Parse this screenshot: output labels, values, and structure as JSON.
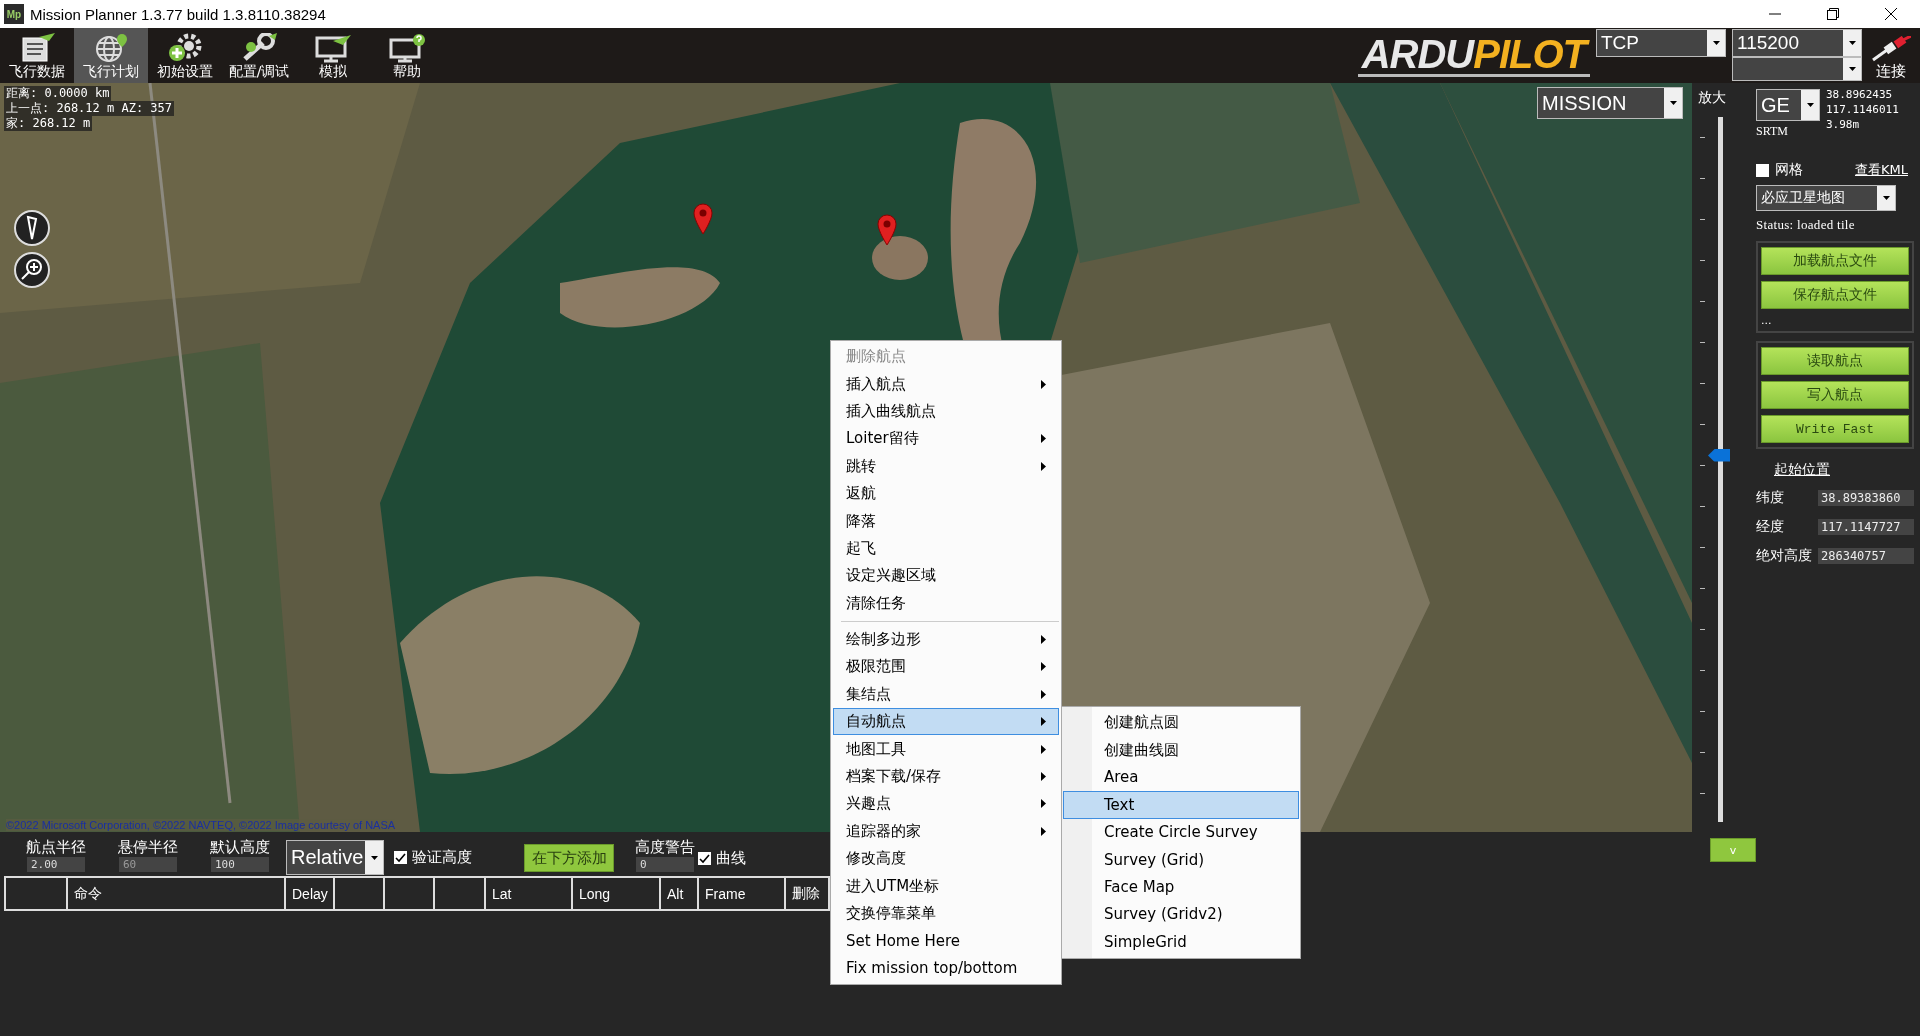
{
  "window": {
    "icon_text": "Mp",
    "title": "Mission Planner 1.3.77 build 1.3.8110.38294"
  },
  "toolbar": {
    "buttons": [
      {
        "label": "飞行数据",
        "selected": false
      },
      {
        "label": "飞行计划",
        "selected": true
      },
      {
        "label": "初始设置",
        "selected": false
      },
      {
        "label": "配置/调试",
        "selected": false
      },
      {
        "label": "模拟",
        "selected": false
      },
      {
        "label": "帮助",
        "selected": false
      }
    ],
    "logo": [
      "ARDU",
      "PILOT"
    ],
    "connection_type": "TCP",
    "baud_rate": "115200",
    "connect_label": "连接"
  },
  "map": {
    "info_lines": [
      "距离: 0.0000 km",
      "上一点: 268.12 m AZ: 357",
      "家: 268.12 m"
    ],
    "mode": "MISSION",
    "attribution": "©2022 Microsoft Corporation, ©2022 NAVTEQ, ©2022 Image courtesy of NASA"
  },
  "zoom": {
    "label": "放大",
    "level": 0.52
  },
  "side_panel": {
    "coord_system": "GE",
    "lat": "38.8962435",
    "lng": "117.1146011",
    "source": "SRTM",
    "alt": "3.98m",
    "grid": {
      "label": "网格",
      "checked": false
    },
    "kml_link": "查看KML",
    "map_type": "必应卫星地图",
    "status": "Status: loaded tile",
    "file_buttons": [
      "加载航点文件",
      "保存航点文件"
    ],
    "file_more": "...",
    "wp_buttons": [
      "读取航点",
      "写入航点",
      "Write Fast"
    ],
    "home": {
      "title": "起始位置",
      "fields": [
        {
          "label": "纬度",
          "value": "38.89383860"
        },
        {
          "label": "经度",
          "value": "117.1147727"
        },
        {
          "label": "绝对高度",
          "value": "286340757"
        }
      ]
    }
  },
  "mission_bar": {
    "fields": [
      {
        "label": "航点半径",
        "value": "2.00",
        "disabled": false
      },
      {
        "label": "悬停半径",
        "value": "60",
        "disabled": true
      },
      {
        "label": "默认高度",
        "value": "100",
        "disabled": false
      }
    ],
    "frame": "Relative",
    "verify_height": {
      "label": "验证高度",
      "checked": true
    },
    "add_below": "在下方添加",
    "alt_warning": {
      "label": "高度警告",
      "value": "0"
    },
    "spline": {
      "label": "曲线",
      "checked": true
    },
    "collapse": "v"
  },
  "table": {
    "columns": [
      "",
      "命令",
      "Delay",
      "",
      "",
      "",
      "Lat",
      "Long",
      "Alt",
      "Frame",
      "删除"
    ]
  },
  "context_menu": {
    "groups": [
      [
        {
          "label": "删除航点",
          "submenu": false,
          "disabled": true,
          "selected": false
        },
        {
          "label": "插入航点",
          "submenu": true,
          "disabled": false,
          "selected": false
        },
        {
          "label": "插入曲线航点",
          "submenu": false,
          "disabled": false,
          "selected": false
        },
        {
          "label": "Loiter留待",
          "submenu": true,
          "disabled": false,
          "selected": false
        },
        {
          "label": "跳转",
          "submenu": true,
          "disabled": false,
          "selected": false
        },
        {
          "label": "返航",
          "submenu": false,
          "disabled": false,
          "selected": false
        },
        {
          "label": "降落",
          "submenu": false,
          "disabled": false,
          "selected": false
        },
        {
          "label": "起飞",
          "submenu": false,
          "disabled": false,
          "selected": false
        },
        {
          "label": "设定兴趣区域",
          "submenu": false,
          "disabled": false,
          "selected": false
        },
        {
          "label": "清除任务",
          "submenu": false,
          "disabled": false,
          "selected": false
        }
      ],
      [
        {
          "label": "绘制多边形",
          "submenu": true,
          "disabled": false,
          "selected": false
        },
        {
          "label": "极限范围",
          "submenu": true,
          "disabled": false,
          "selected": false
        },
        {
          "label": "集结点",
          "submenu": true,
          "disabled": false,
          "selected": false
        },
        {
          "label": "自动航点",
          "submenu": true,
          "disabled": false,
          "selected": true
        },
        {
          "label": "地图工具",
          "submenu": true,
          "disabled": false,
          "selected": false
        },
        {
          "label": "档案下载/保存",
          "submenu": true,
          "disabled": false,
          "selected": false
        },
        {
          "label": "兴趣点",
          "submenu": true,
          "disabled": false,
          "selected": false
        },
        {
          "label": "追踪器的家",
          "submenu": true,
          "disabled": false,
          "selected": false
        },
        {
          "label": "修改高度",
          "submenu": false,
          "disabled": false,
          "selected": false
        },
        {
          "label": "进入UTM坐标",
          "submenu": false,
          "disabled": false,
          "selected": false
        },
        {
          "label": "交换停靠菜单",
          "submenu": false,
          "disabled": false,
          "selected": false
        },
        {
          "label": "Set Home Here",
          "submenu": false,
          "disabled": false,
          "selected": false
        },
        {
          "label": "Fix mission top/bottom",
          "submenu": false,
          "disabled": false,
          "selected": false
        }
      ]
    ],
    "submenu": [
      {
        "label": "创建航点圆",
        "selected": false
      },
      {
        "label": "创建曲线圆",
        "selected": false
      },
      {
        "label": "Area",
        "selected": false
      },
      {
        "label": "Text",
        "selected": true
      },
      {
        "label": "Create Circle Survey",
        "selected": false
      },
      {
        "label": "Survey (Grid)",
        "selected": false
      },
      {
        "label": "Face Map",
        "selected": false
      },
      {
        "label": "Survey (Gridv2)",
        "selected": false
      },
      {
        "label": "SimpleGrid",
        "selected": false
      }
    ]
  }
}
